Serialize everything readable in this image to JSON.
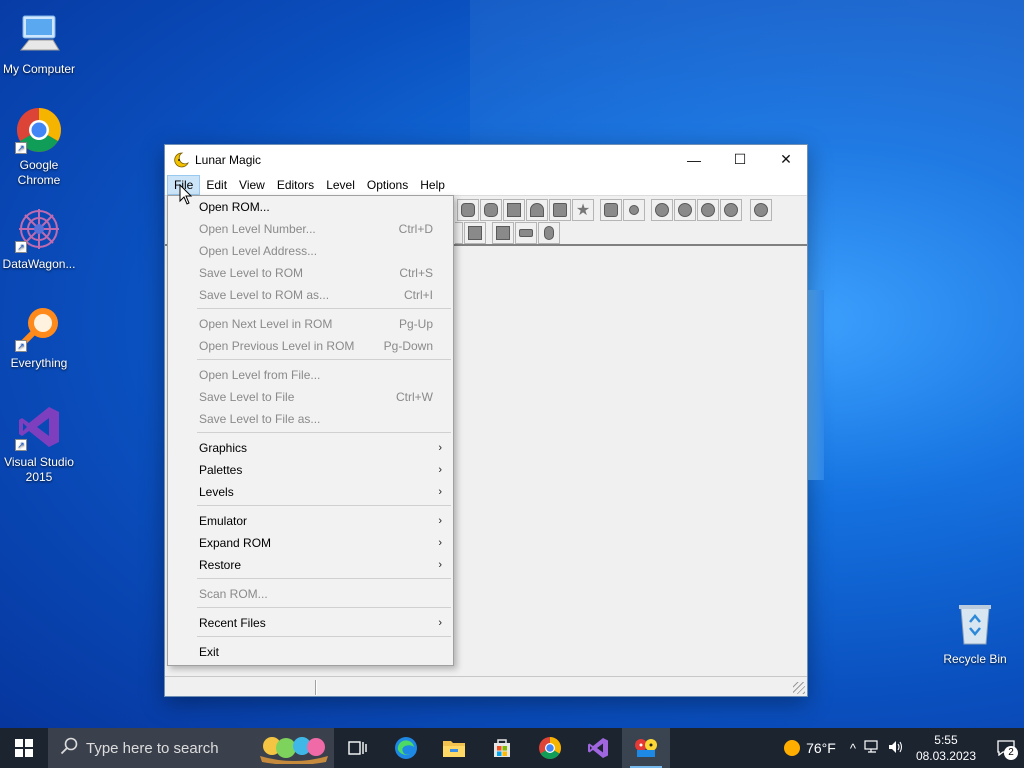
{
  "desktop": {
    "icons": [
      {
        "label": "My Computer"
      },
      {
        "label": "Google Chrome"
      },
      {
        "label": "DataWagon..."
      },
      {
        "label": "Everything"
      },
      {
        "label": "Visual Studio 2015"
      },
      {
        "label": "Recycle Bin"
      }
    ]
  },
  "window": {
    "title": "Lunar Magic",
    "controls": {
      "minimize": "—",
      "maximize": "☐",
      "close": "✕"
    },
    "menu": [
      "File",
      "Edit",
      "View",
      "Editors",
      "Level",
      "Options",
      "Help"
    ],
    "active_menu": "File"
  },
  "file_menu": {
    "items": [
      {
        "label": "Open ROM...",
        "shortcut": "",
        "enabled": true,
        "submenu": false
      },
      {
        "label": "Open Level Number...",
        "shortcut": "Ctrl+D",
        "enabled": false,
        "submenu": false
      },
      {
        "label": "Open Level Address...",
        "shortcut": "",
        "enabled": false,
        "submenu": false
      },
      {
        "label": "Save Level to ROM",
        "shortcut": "Ctrl+S",
        "enabled": false,
        "submenu": false
      },
      {
        "label": "Save Level to ROM as...",
        "shortcut": "Ctrl+I",
        "enabled": false,
        "submenu": false
      },
      {
        "label": "Open Next Level in ROM",
        "shortcut": "Pg-Up",
        "enabled": false,
        "submenu": false
      },
      {
        "label": "Open Previous Level in ROM",
        "shortcut": "Pg-Down",
        "enabled": false,
        "submenu": false
      },
      {
        "label": "Open Level from File...",
        "shortcut": "",
        "enabled": false,
        "submenu": false
      },
      {
        "label": "Save Level to File",
        "shortcut": "Ctrl+W",
        "enabled": false,
        "submenu": false
      },
      {
        "label": "Save Level to File as...",
        "shortcut": "",
        "enabled": false,
        "submenu": false
      },
      {
        "label": "Graphics",
        "shortcut": "",
        "enabled": true,
        "submenu": true
      },
      {
        "label": "Palettes",
        "shortcut": "",
        "enabled": true,
        "submenu": true
      },
      {
        "label": "Levels",
        "shortcut": "",
        "enabled": true,
        "submenu": true
      },
      {
        "label": "Emulator",
        "shortcut": "",
        "enabled": true,
        "submenu": true
      },
      {
        "label": "Expand ROM",
        "shortcut": "",
        "enabled": true,
        "submenu": true
      },
      {
        "label": "Restore",
        "shortcut": "",
        "enabled": true,
        "submenu": true
      },
      {
        "label": "Scan ROM...",
        "shortcut": "",
        "enabled": false,
        "submenu": false
      },
      {
        "label": "Recent Files",
        "shortcut": "",
        "enabled": true,
        "submenu": true
      },
      {
        "label": "Exit",
        "shortcut": "",
        "enabled": true,
        "submenu": false
      }
    ],
    "submenu_arrow": "›"
  },
  "taskbar": {
    "search_placeholder": "Type here to search",
    "weather": "76°F",
    "time": "5:55",
    "date": "08.03.2023",
    "notification_count": "2",
    "tray_chevron": "^"
  },
  "colors": {
    "desktop_blue": "#0a4fbe",
    "taskbar": "#1c2430",
    "menu_highlight": "#cce4f7"
  }
}
